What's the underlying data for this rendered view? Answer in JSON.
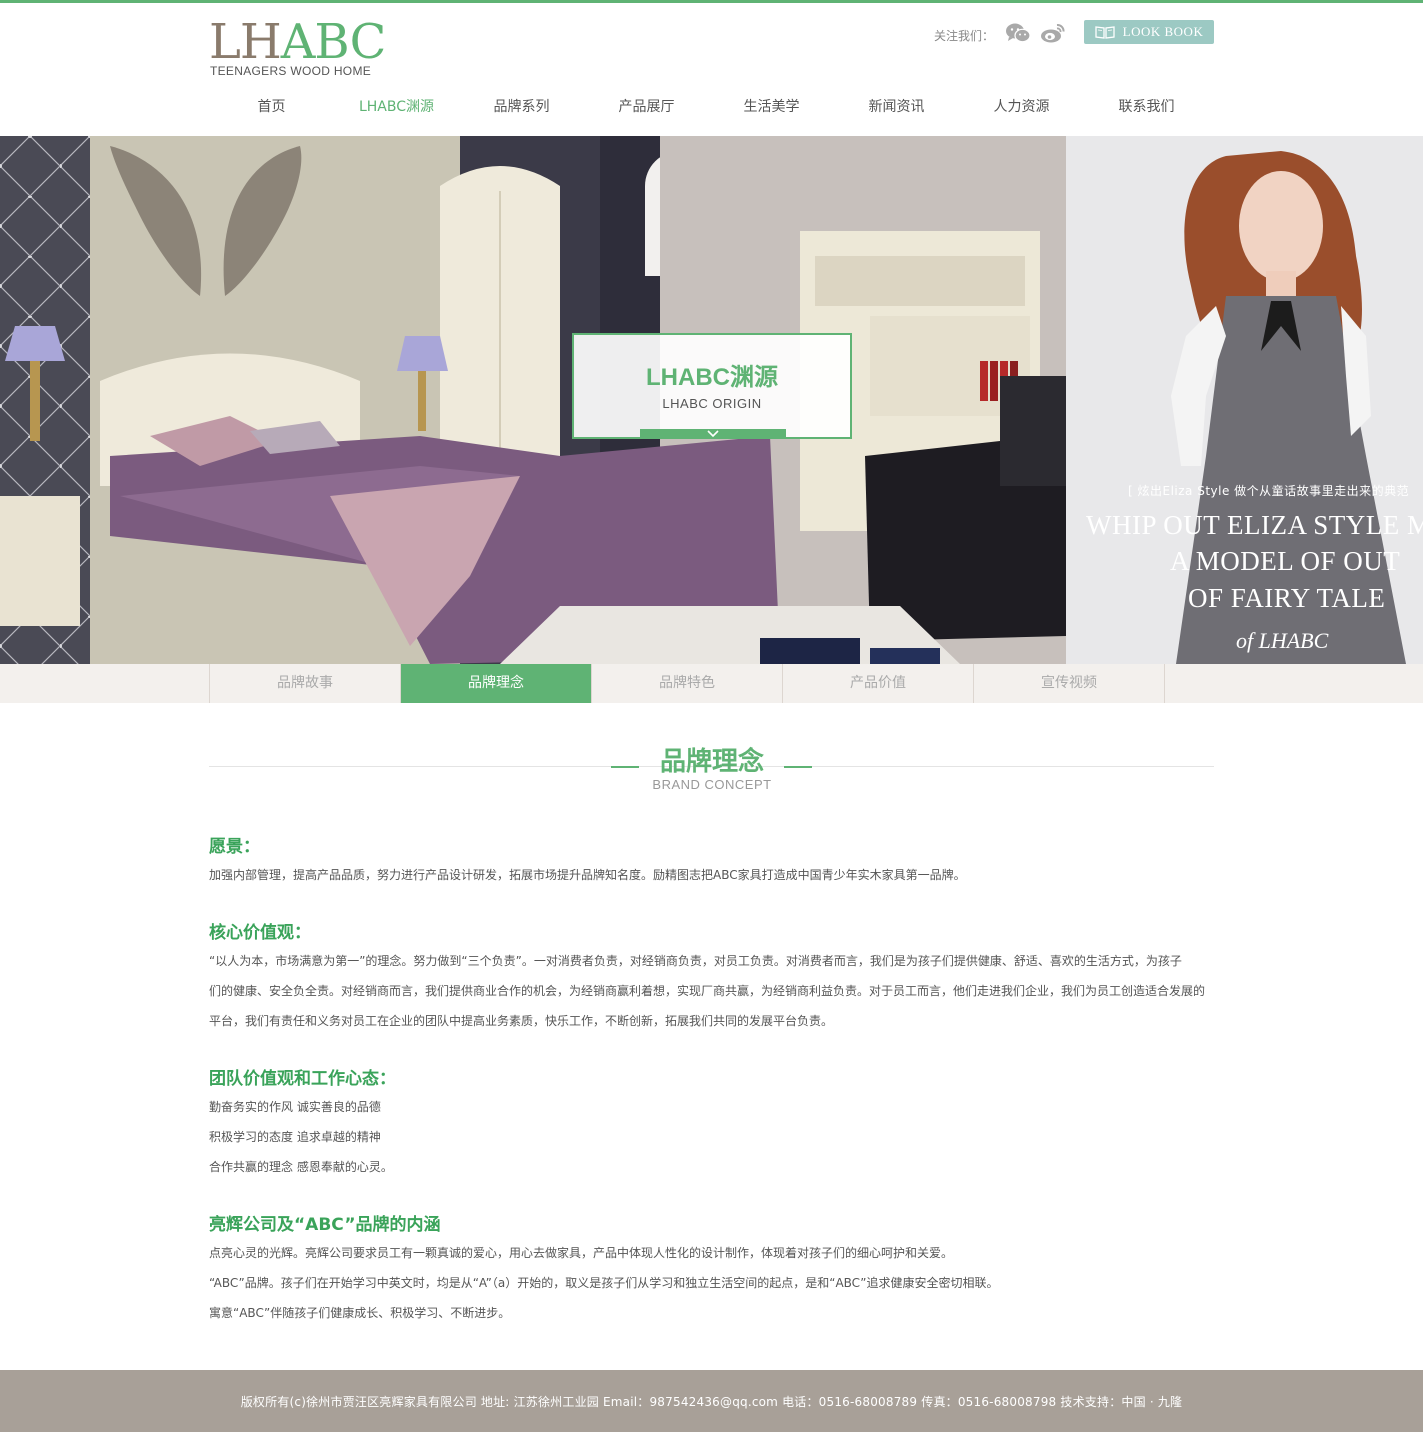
{
  "brand": {
    "logo_lh": "LH",
    "logo_abc": "ABC",
    "logo_sub": "TEENAGERS WOOD HOME"
  },
  "header": {
    "follow_label": "关注我们：",
    "lookbook_label": "LOOK BOOK",
    "social_icons": [
      "wechat-icon",
      "weibo-icon"
    ]
  },
  "nav": {
    "items": [
      "首页",
      "LHABC渊源",
      "品牌系列",
      "产品展厅",
      "生活美学",
      "新闻资讯",
      "人力资源",
      "联系我们"
    ],
    "active_index": 1
  },
  "banner": {
    "title": "LHABC渊源",
    "subtitle": "LHABC ORIGIN",
    "promo_tag": "[ 炫出Eliza Style 做个从童话故事里走出来的典范",
    "promo_lines": [
      "WHIP OUT ELIZA STYLE M",
      "A MODEL OF OUT",
      "OF FAIRY TALE"
    ],
    "promo_of": "of LHABC"
  },
  "subtabs": {
    "items": [
      "品牌故事",
      "品牌理念",
      "品牌特色",
      "产品价值",
      "宣传视频"
    ],
    "active_index": 1
  },
  "section": {
    "title": "品牌理念",
    "subtitle": "BRAND CONCEPT"
  },
  "article": {
    "vision_heading": "愿景：",
    "vision_text": "加强内部管理，提高产品品质，努力进行产品设计研发，拓展市场提升品牌知名度。励精图志把ABC家具打造成中国青少年实木家具第一品牌。",
    "core_heading": "核心价值观：",
    "core_lines": [
      "“以人为本，市场满意为第一”的理念。努力做到“三个负责”。一对消费者负责，对经销商负责，对员工负责。对消费者而言，我们是为孩子们提供健康、舒适、喜欢的生活方式，为孩子",
      "们的健康、安全负全责。对经销商而言，我们提供商业合作的机会，为经销商赢利着想，实现厂商共赢，为经销商利益负责。对于员工而言，他们走进我们企业，我们为员工创造适合发展的",
      "平台，我们有责任和义务对员工在企业的团队中提高业务素质，快乐工作，不断创新，拓展我们共同的发展平台负责。"
    ],
    "team_heading": "团队价值观和工作心态：",
    "team_lines": [
      "勤奋务实的作风 诚实善良的品德",
      "积极学习的态度 追求卓越的精神",
      "合作共赢的理念 感恩奉献的心灵。"
    ],
    "meaning_heading": "亮辉公司及“ABC”品牌的内涵",
    "meaning_lines": [
      "点亮心灵的光辉。亮辉公司要求员工有一颗真诚的爱心，用心去做家具，产品中体现人性化的设计制作，体现着对孩子们的细心呵护和关爱。",
      "“ABC”品牌。孩子们在开始学习中英文时，均是从“A”（a）开始的，取义是孩子们从学习和独立生活空间的起点，是和“ABC”追求健康安全密切相联。",
      "寓意“ABC”伴随孩子们健康成长、积极学习、不断进步。"
    ]
  },
  "footer": {
    "text": "版权所有(c)徐州市贾汪区亮辉家具有限公司    地址: 江苏徐州工业园    Email：987542436@qq.com    电话：0516-68008789    传真：0516-68008798    技术支持：中国 · 九隆"
  },
  "colors": {
    "accent_green": "#5fb374",
    "heading_green": "#3aa35a",
    "logo_brown": "#8a7b6c",
    "lookbook_teal": "#9cc9c3",
    "footer_bg": "#a8a098"
  }
}
